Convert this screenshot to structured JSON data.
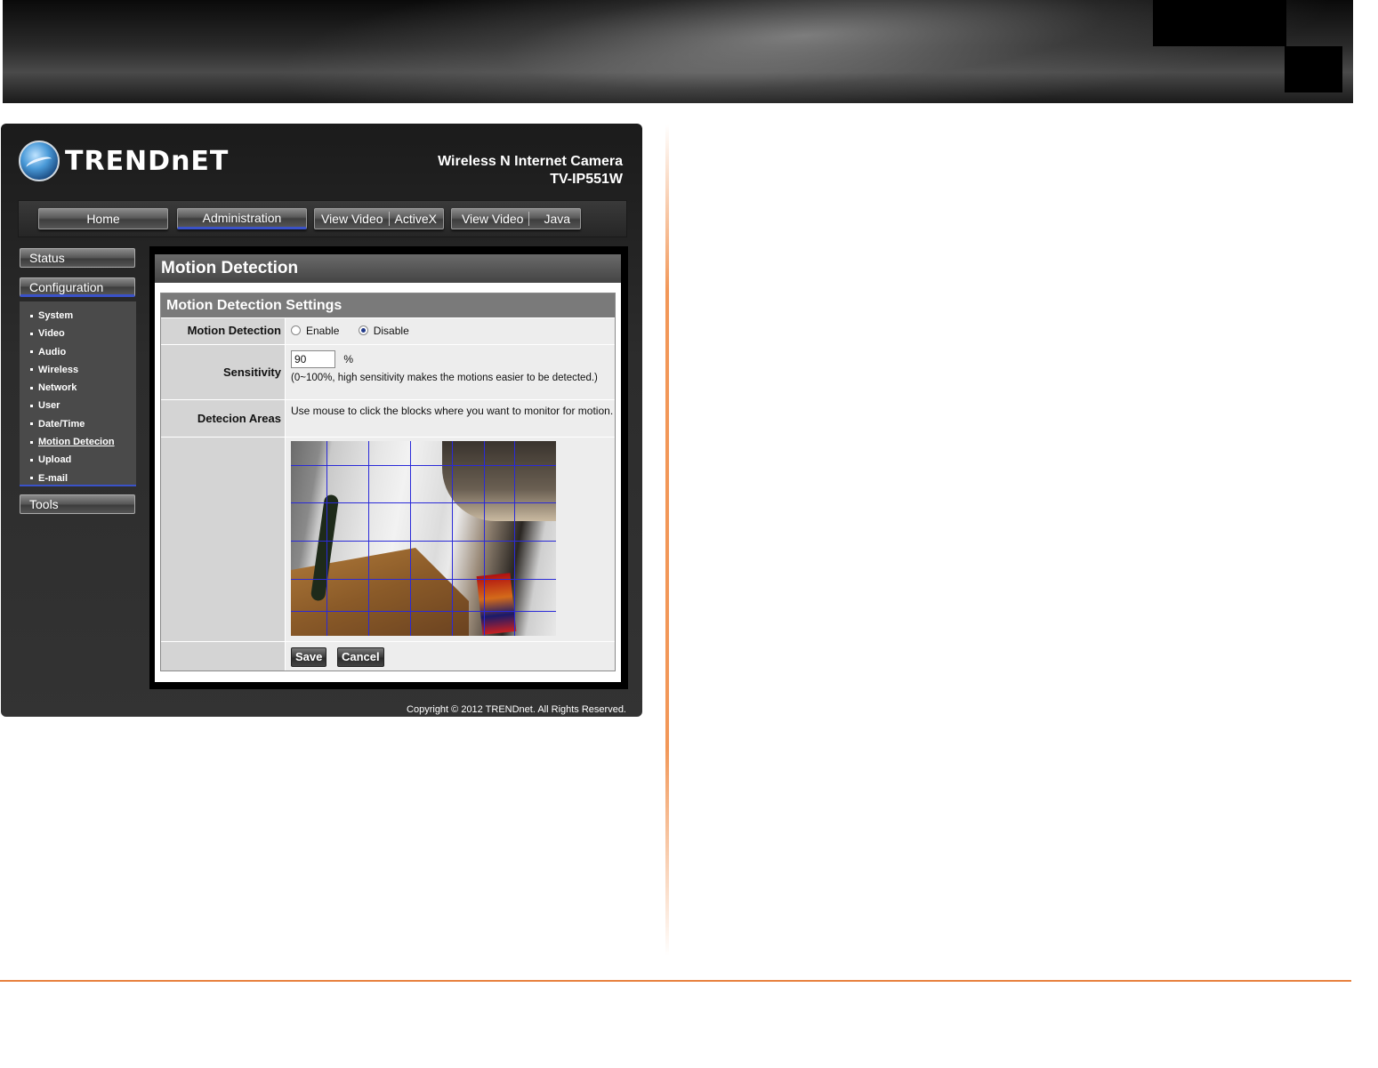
{
  "brand": {
    "logo_text": "TRENDnET",
    "product_line": "Wireless N Internet Camera",
    "model": "TV-IP551W"
  },
  "nav": {
    "home": "Home",
    "administration": "Administration",
    "view_video_activex": [
      "View Video",
      "ActiveX"
    ],
    "view_video_java": [
      "View Video",
      "Java"
    ]
  },
  "sidebar": {
    "status": "Status",
    "configuration": "Configuration",
    "tools": "Tools",
    "items": [
      "System",
      "Video",
      "Audio",
      "Wireless",
      "Network",
      "User",
      "Date/Time",
      "Motion Detecion",
      "Upload",
      "E-mail"
    ]
  },
  "main": {
    "title": "Motion Detection",
    "settings_title": "Motion Detection Settings",
    "motion_label": "Motion Detection",
    "enable": "Enable",
    "disable": "Disable",
    "selected": "Disable",
    "sensitivity_label": "Sensitivity",
    "sensitivity_value": "90",
    "sensitivity_unit": "%",
    "sensitivity_help": "(0~100%, high sensitivity makes the motions easier to be detected.)",
    "areas_label": "Detecion Areas",
    "areas_help": "Use mouse to click the blocks where you want to monitor for motion.",
    "save": "Save",
    "cancel": "Cancel"
  },
  "footer": {
    "copyright": "Copyright © 2012 TRENDnet.  All Rights Reserved."
  },
  "colors": {
    "accent_blue": "#3a52c8",
    "divider_orange": "#e8813f"
  }
}
